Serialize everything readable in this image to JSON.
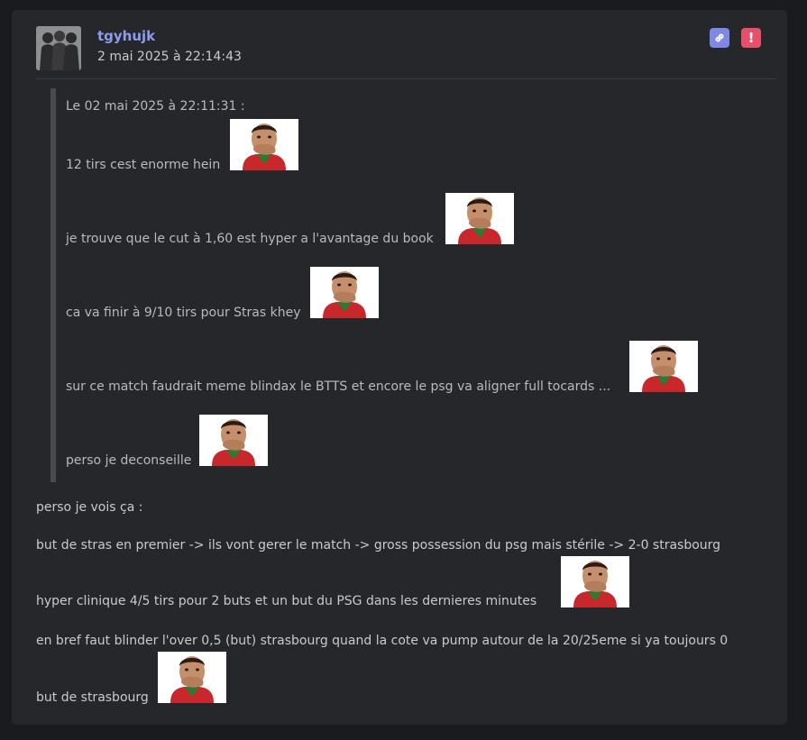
{
  "post": {
    "username": "tgyhujk",
    "date": "2 mai 2025 à 22:14:43",
    "quote": {
      "header": "Le 02 mai 2025 à 22:11:31 :",
      "lines": [
        "12 tirs cest enorme hein",
        "je trouve que le cut à 1,60 est hyper a l'avantage du book",
        "ca va finir à 9/10 tirs pour Stras khey",
        "sur ce match faudrait meme blindax le BTTS et encore le psg va aligner full tocards ...",
        "perso je deconseille"
      ]
    },
    "body": [
      "perso je vois ça :",
      "but de stras en premier -> ils vont gerer le match -> gross possession du psg mais stérile -> 2-0 strasbourg",
      "hyper clinique 4/5 tirs pour 2 buts et un but du PSG dans les dernieres minutes",
      "en bref faut blinder l'over 0,5 (but) strasbourg quand la cote va pump autour de la 20/25eme si ya toujours 0",
      "but de strasbourg"
    ]
  },
  "icons": {
    "link": "link-icon",
    "report": "report-icon",
    "sticker": "cristiano-sticker-icon"
  },
  "colors": {
    "background": "#1a1b1e",
    "card": "#26272b",
    "username": "#8c9df0",
    "link_button": "#7e88e6",
    "report_button": "#e8506a",
    "quote_bar": "#4a4b50"
  }
}
